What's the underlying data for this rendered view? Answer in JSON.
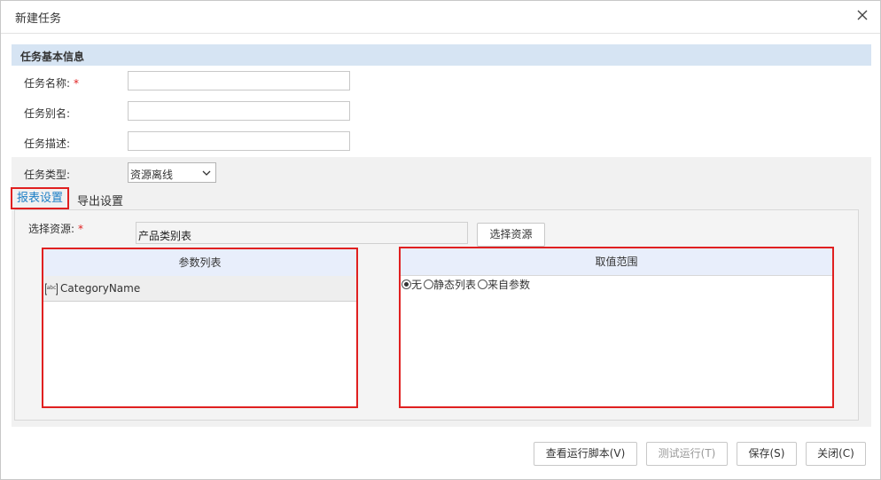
{
  "dialog": {
    "title": "新建任务"
  },
  "section": {
    "basic_info_title": "任务基本信息"
  },
  "form": {
    "task_name_label": "任务名称:",
    "required_mark": "*",
    "task_alias_label": "任务别名:",
    "task_desc_label": "任务描述:",
    "task_type_label": "任务类型:",
    "task_name_value": "",
    "task_alias_value": "",
    "task_desc_value": "",
    "task_type_value": "资源离线"
  },
  "tabs": {
    "report_settings": "报表设置",
    "export_settings": "导出设置"
  },
  "resource": {
    "label": "选择资源:",
    "value": "产品类别表",
    "select_button": "选择资源"
  },
  "param_list": {
    "header": "参数列表",
    "items": [
      {
        "name": "CategoryName"
      }
    ]
  },
  "value_range": {
    "header": "取值范围",
    "options": [
      "无",
      "静态列表",
      "来自参数"
    ],
    "selected": "无"
  },
  "footer": {
    "view_script": "查看运行脚本(V)",
    "test_run": "测试运行(T)",
    "save": "保存(S)",
    "close": "关闭(C)"
  },
  "colors": {
    "accent": "#1d7fc6",
    "highlight_border": "#e02020",
    "section_band": "#d6e4f3"
  }
}
